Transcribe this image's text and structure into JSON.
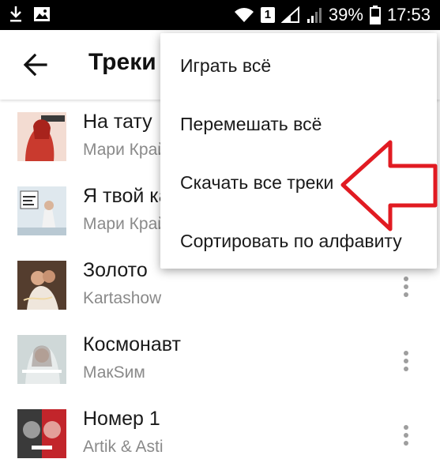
{
  "status_bar": {
    "battery_percent": "39%",
    "time": "17:53",
    "sim_number": "1"
  },
  "app_bar": {
    "title": "Треки"
  },
  "menu": {
    "items": [
      {
        "label": "Играть всё"
      },
      {
        "label": "Перемешать всё"
      },
      {
        "label": "Скачать все треки"
      },
      {
        "label": "Сортировать по алфавиту"
      }
    ]
  },
  "tracks": [
    {
      "title": "На тату",
      "artist": "Мари Краймбрери"
    },
    {
      "title": "Я твой кайф",
      "artist": "Мари Краймбрери"
    },
    {
      "title": "Золото",
      "artist": "Kartashow"
    },
    {
      "title": "Космонавт",
      "artist": "МакSим"
    },
    {
      "title": "Номер 1",
      "artist": "Artik & Asti"
    }
  ],
  "colors": {
    "accent_arrow": "#e11b22",
    "status_bar_bg": "#000000",
    "muted_text": "#8a8a8a"
  }
}
